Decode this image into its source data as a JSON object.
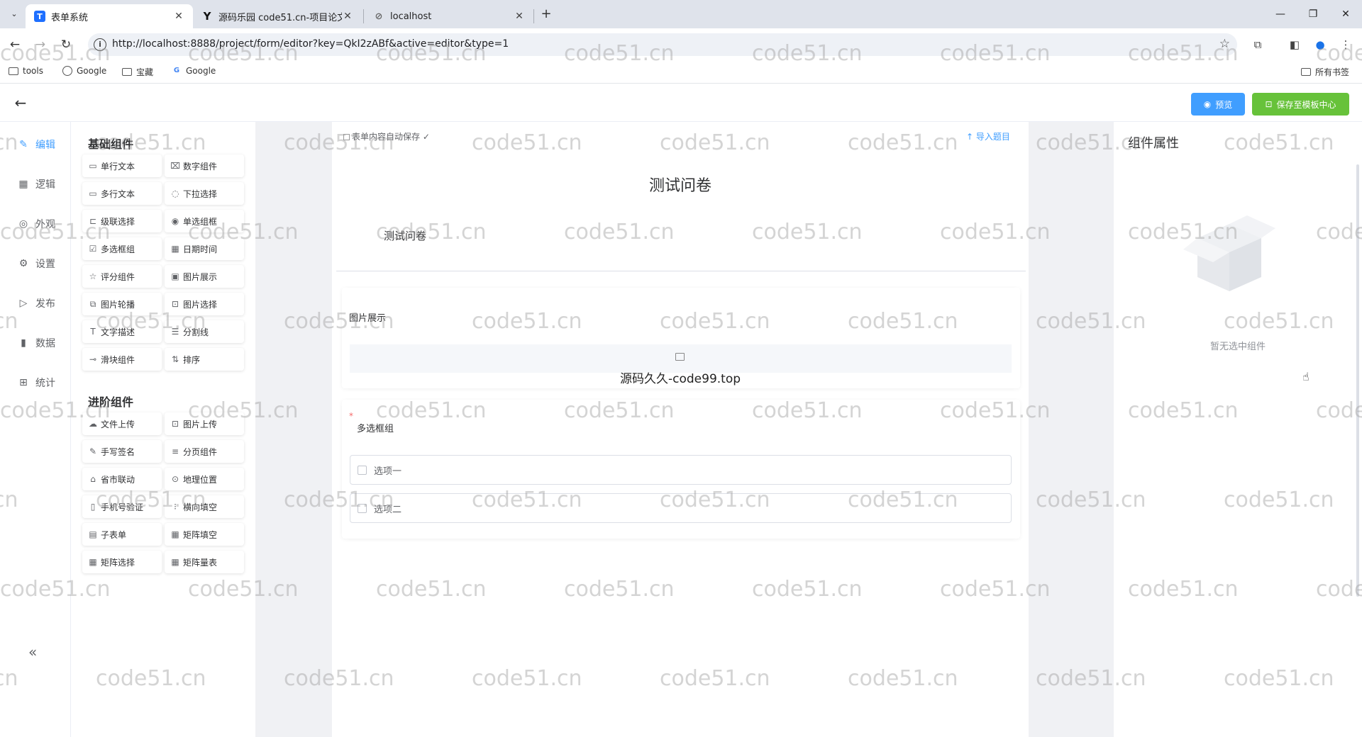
{
  "browser": {
    "tab_list_label": "⌄",
    "tabs": [
      {
        "favicon": "T",
        "title": "表单系统",
        "active": true
      },
      {
        "favicon": "Y",
        "title": "源码乐园 code51.cn-项目论文",
        "active": false
      },
      {
        "favicon": "⊘",
        "title": "localhost",
        "active": false
      }
    ],
    "close_label": "✕",
    "new_tab_label": "+",
    "url": "http://localhost:8888/project/form/editor?key=QkI2zABf&active=editor&type=1",
    "bookmarks": [
      {
        "icon": "folder-icon",
        "label": "tools"
      },
      {
        "icon": "globe-icon",
        "label": "Google"
      },
      {
        "icon": "folder-icon",
        "label": "宝藏"
      },
      {
        "icon": "google-g-icon",
        "label": "Google"
      }
    ],
    "all_bookmarks_label": "所有书签"
  },
  "header": {
    "preview_label": "预览",
    "save_template_label": "保存至模板中心"
  },
  "left_nav": {
    "items": [
      {
        "icon": "edit-icon",
        "label": "编辑",
        "active": true
      },
      {
        "icon": "grid-icon",
        "label": "逻辑",
        "active": false
      },
      {
        "icon": "eye-icon",
        "label": "外观",
        "active": false
      },
      {
        "icon": "gear-icon",
        "label": "设置",
        "active": false
      },
      {
        "icon": "play-icon",
        "label": "发布",
        "active": false
      },
      {
        "icon": "bar-chart-icon",
        "label": "数据",
        "active": false
      },
      {
        "icon": "stats-icon",
        "label": "统计",
        "active": false
      }
    ],
    "collapse_label": "«"
  },
  "components": {
    "basic_title": "基础组件",
    "basic": [
      {
        "icon": "▭",
        "label": "单行文本"
      },
      {
        "icon": "⌧",
        "label": "数字组件"
      },
      {
        "icon": "▭",
        "label": "多行文本"
      },
      {
        "icon": "◌",
        "label": "下拉选择"
      },
      {
        "icon": "⊏",
        "label": "级联选择"
      },
      {
        "icon": "◉",
        "label": "单选组框"
      },
      {
        "icon": "☑",
        "label": "多选框组"
      },
      {
        "icon": "▦",
        "label": "日期时间"
      },
      {
        "icon": "☆",
        "label": "评分组件"
      },
      {
        "icon": "▣",
        "label": "图片展示"
      },
      {
        "icon": "⧉",
        "label": "图片轮播"
      },
      {
        "icon": "⊡",
        "label": "图片选择"
      },
      {
        "icon": "T",
        "label": "文字描述"
      },
      {
        "icon": "☰",
        "label": "分割线"
      },
      {
        "icon": "⊸",
        "label": "滑块组件"
      },
      {
        "icon": "⇅",
        "label": "排序"
      }
    ],
    "advanced_title": "进阶组件",
    "advanced": [
      {
        "icon": "☁",
        "label": "文件上传"
      },
      {
        "icon": "⊡",
        "label": "图片上传"
      },
      {
        "icon": "✎",
        "label": "手写签名"
      },
      {
        "icon": "≡",
        "label": "分页组件"
      },
      {
        "icon": "⌂",
        "label": "省市联动"
      },
      {
        "icon": "⊙",
        "label": "地理位置"
      },
      {
        "icon": "▯",
        "label": "手机号验证"
      },
      {
        "icon": "⁝",
        "label": "横向填空"
      },
      {
        "icon": "▤",
        "label": "子表单"
      },
      {
        "icon": "▦",
        "label": "矩阵填空"
      },
      {
        "icon": "▦",
        "label": "矩阵选择"
      },
      {
        "icon": "▦",
        "label": "矩阵量表"
      }
    ]
  },
  "canvas": {
    "autosave_text": "表单内容自动保存 ✓",
    "import_label": "↑ 导入题目",
    "form_title": "测试问卷",
    "form_description": "测试问卷",
    "image_question": {
      "label": "图片展示",
      "caption": "源码久久-code99.top"
    },
    "checkbox_question": {
      "required_mark": "*",
      "label": "多选框组",
      "options": [
        "选项一",
        "选项二"
      ]
    }
  },
  "properties": {
    "title": "组件属性",
    "empty_text": "暂无选中组件"
  },
  "watermark": "code51.cn",
  "colors": {
    "primary": "#409eff",
    "success": "#67c23a",
    "canvas_bg": "#f0f1f4"
  }
}
